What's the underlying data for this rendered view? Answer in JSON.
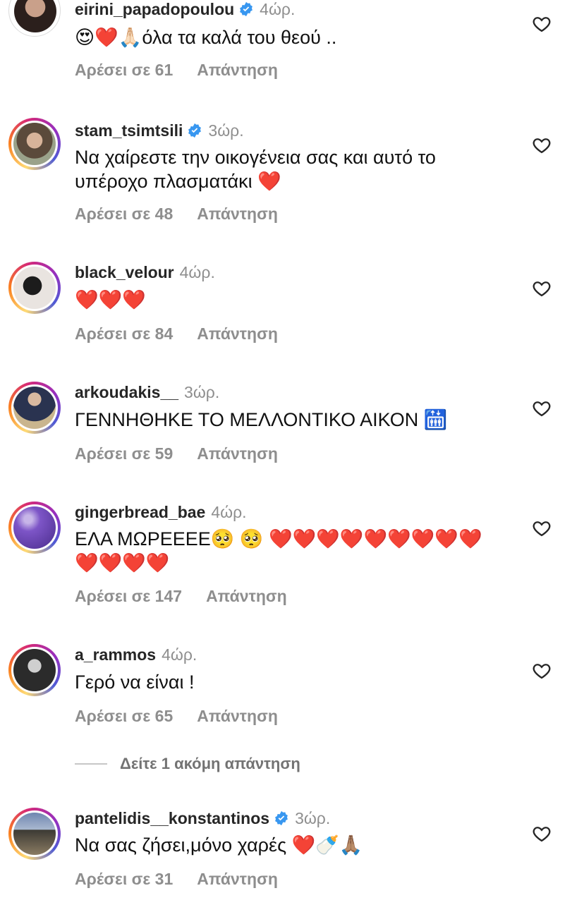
{
  "comments": [
    {
      "username": "eirini_papadopoulou",
      "verified": true,
      "time": "4ώρ.",
      "text": "😍❤️🙏🏻όλα τα καλά του θεού ..",
      "likes": "Αρέσει σε 61",
      "reply": "Απάντηση",
      "story_ring": false
    },
    {
      "username": "stam_tsimtsili",
      "verified": true,
      "time": "3ώρ.",
      "text": "Να χαίρεστε την οικογένεια σας και αυτό το υπέροχο πλασματάκι ❤️",
      "likes": "Αρέσει σε 48",
      "reply": "Απάντηση",
      "story_ring": true
    },
    {
      "username": "black_velour",
      "verified": false,
      "time": "4ώρ.",
      "text": "❤️❤️❤️",
      "likes": "Αρέσει σε 84",
      "reply": "Απάντηση",
      "story_ring": true
    },
    {
      "username": "arkoudakis__",
      "verified": false,
      "time": "3ώρ.",
      "text": "ΓΕΝΝΗΘΗΚΕ ΤΟ ΜΕΛΛΟΝΤΙΚΟ ΑΙΚΟΝ 🛗",
      "likes": "Αρέσει σε 59",
      "reply": "Απάντηση",
      "story_ring": true
    },
    {
      "username": "gingerbread_bae",
      "verified": false,
      "time": "4ώρ.",
      "text": "ΕΛΑ ΜΩΡΕΕΕΕ🥺 🥺 ❤️❤️❤️❤️❤️❤️❤️❤️❤️❤️❤️❤️❤️",
      "likes": "Αρέσει σε 147",
      "reply": "Απάντηση",
      "story_ring": true
    },
    {
      "username": "a_rammos",
      "verified": false,
      "time": "4ώρ.",
      "text": "Γερό να είναι !",
      "likes": "Αρέσει σε 65",
      "reply": "Απάντηση",
      "story_ring": true
    },
    {
      "username": "pantelidis__konstantinos",
      "verified": true,
      "time": "3ώρ.",
      "text": "Να σας ζήσει,μόνο χαρές ❤️🍼🙏🏽",
      "likes": "Αρέσει σε 31",
      "reply": "Απάντηση",
      "story_ring": true
    }
  ],
  "view_more": "Δείτε 1 ακόμη απάντηση",
  "colors": {
    "verified": "#3897f0",
    "meta_gray": "#8e8e8e",
    "heart_red": "#ed4956"
  },
  "icons": {
    "like": "heart-outline-icon",
    "verified": "verified-badge-icon"
  }
}
